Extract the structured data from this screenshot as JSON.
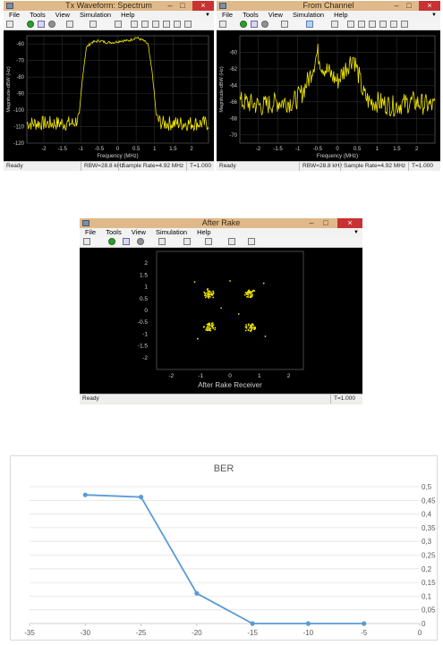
{
  "menu": [
    "File",
    "Tools",
    "View",
    "Simulation",
    "Help"
  ],
  "tx": {
    "title": "Tx Waveform: Spectrum",
    "xlabel": "Frequency (MHz)",
    "ylabel": "Magnitude-dBW (Hz)",
    "yticks": [
      "-60",
      "-70",
      "-80",
      "-90",
      "-100",
      "-110",
      "-120"
    ],
    "xticks": [
      "-2",
      "-1.5",
      "-1",
      "-0.5",
      "0",
      "0.5",
      "1",
      "1.5",
      "2"
    ],
    "status_ready": "Ready",
    "rbw": "RBW=28.8 kHz",
    "sample_rate": "Sample Rate=4.92 MHz",
    "time": "T=1.000"
  },
  "channel": {
    "title": "From Channel",
    "xlabel": "Frequency (MHz)",
    "ylabel": "Magnitude-dBW (Hz)",
    "yticks": [
      "-60",
      "-62",
      "-64",
      "-66",
      "-68",
      "-70"
    ],
    "xticks": [
      "-2",
      "-1.5",
      "-1",
      "-0.5",
      "0",
      "0.5",
      "1",
      "1.5",
      "2"
    ],
    "status_ready": "Ready",
    "rbw": "RBW=28.8 kHz",
    "sample_rate": "Sample Rate=4.92 MHz",
    "time": "T=1.000"
  },
  "rake": {
    "title": "After Rake",
    "xlabel": "After Rake Receiver",
    "yticks": [
      "2",
      "1.5",
      "1",
      "0.5",
      "0",
      "-0.5",
      "-1",
      "-1.5",
      "-2"
    ],
    "xticks": [
      "-2",
      "-1",
      "0",
      "1",
      "2"
    ],
    "status_ready": "Ready",
    "time": "T=1.000"
  },
  "ber": {
    "title": "BER",
    "xticks": [
      "-35",
      "-30",
      "-25",
      "-20",
      "-15",
      "-10",
      "-5",
      "0"
    ],
    "yticks": [
      "0,5",
      "0,45",
      "0,4",
      "0,35",
      "0,3",
      "0,25",
      "0,2",
      "0,15",
      "0,1",
      "0,05",
      "0"
    ]
  },
  "colors": {
    "trace": "#f2e800",
    "ber_line": "#5b9bd5",
    "titlebar": "#e0b98a"
  },
  "chart_data": [
    {
      "type": "line",
      "title": "Tx Waveform: Spectrum",
      "xlabel": "Frequency (MHz)",
      "ylabel": "Magnitude-dBW (Hz)",
      "xlim": [
        -2.46,
        2.46
      ],
      "ylim": [
        -120,
        -55
      ],
      "series": [
        {
          "x": [
            -2.4,
            -1.2,
            -1.05,
            -0.95,
            -0.85,
            -0.7,
            -0.5,
            -0.3,
            -0.1,
            0.1,
            0.3,
            0.5,
            0.7,
            0.82,
            0.95,
            1.05,
            1.2,
            2.4
          ],
          "values": [
            -108,
            -108,
            -105,
            -80,
            -62,
            -59,
            -58,
            -59,
            -59,
            -58,
            -58,
            -56,
            -58,
            -60,
            -80,
            -105,
            -108,
            -108
          ]
        }
      ]
    },
    {
      "type": "line",
      "title": "From Channel",
      "xlabel": "Frequency (MHz)",
      "ylabel": "Magnitude-dBW (Hz)",
      "xlim": [
        -2.46,
        2.46
      ],
      "ylim": [
        -71,
        -58
      ],
      "series": [
        {
          "x": [
            -2.4,
            -1.9,
            -1.5,
            -1.1,
            -0.9,
            -0.7,
            -0.6,
            -0.5,
            -0.4,
            -0.2,
            0,
            0.2,
            0.4,
            0.55,
            0.65,
            0.8,
            1.0,
            1.4,
            1.9,
            2.4
          ],
          "values": [
            -66,
            -66.5,
            -66,
            -66,
            -65,
            -63,
            -61.5,
            -60,
            -61.5,
            -62.5,
            -63.5,
            -62,
            -60.5,
            -63,
            -65,
            -66,
            -66,
            -66.5,
            -66,
            -66.5
          ]
        }
      ]
    },
    {
      "type": "scatter",
      "title": "After Rake",
      "xlabel": "After Rake Receiver",
      "xlim": [
        -2.5,
        2.5
      ],
      "ylim": [
        -2.5,
        2.5
      ],
      "clusters": [
        {
          "x": -0.7,
          "y": 0.7
        },
        {
          "x": 0.7,
          "y": 0.7
        },
        {
          "x": -0.7,
          "y": -0.7
        },
        {
          "x": 0.7,
          "y": -0.7
        }
      ]
    },
    {
      "type": "line",
      "title": "BER",
      "xlim": [
        -35,
        0
      ],
      "ylim": [
        0,
        0.5
      ],
      "x": [
        -30,
        -25,
        -20,
        -15,
        -10,
        -5
      ],
      "series": [
        {
          "values": [
            0.47,
            0.462,
            0.11,
            0,
            0,
            0
          ]
        }
      ]
    }
  ]
}
